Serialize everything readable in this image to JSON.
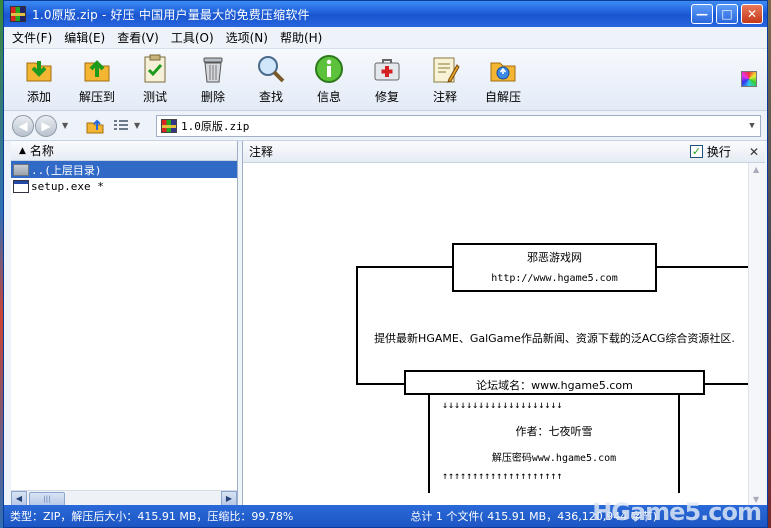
{
  "window": {
    "title": "1.0原版.zip - 好压 中国用户量最大的免费压缩软件",
    "buttons": {
      "minimize": "—",
      "maximize": "□",
      "close": "✕"
    }
  },
  "menu": [
    "文件(F)",
    "编辑(E)",
    "查看(V)",
    "工具(O)",
    "选项(N)",
    "帮助(H)"
  ],
  "toolbar": [
    {
      "label": "添加",
      "icon": "add-icon"
    },
    {
      "label": "解压到",
      "icon": "extract-icon"
    },
    {
      "label": "测试",
      "icon": "test-icon"
    },
    {
      "label": "删除",
      "icon": "delete-icon"
    },
    {
      "label": "查找",
      "icon": "search-icon"
    },
    {
      "label": "信息",
      "icon": "info-icon"
    },
    {
      "label": "修复",
      "icon": "repair-icon"
    },
    {
      "label": "注释",
      "icon": "comment-icon"
    },
    {
      "label": "自解压",
      "icon": "sfx-icon"
    }
  ],
  "address": {
    "path": "1.0原版.zip"
  },
  "file_list": {
    "column": "名称",
    "rows": [
      {
        "name": "..(上层目录)",
        "type": "folder",
        "selected": true
      },
      {
        "name": "setup.exe *",
        "type": "exe",
        "selected": false
      }
    ]
  },
  "comment_pane": {
    "title": "注释",
    "wrap_label": "换行",
    "wrap_checked": true,
    "art": {
      "site_name": "邪恶游戏网",
      "site_url": "http://www.hgame5.com",
      "description": "提供最新HGAME、GalGame作品新闻、资源下载的泛ACG综合资源社区.",
      "forum": "论坛域名：www.hgame5.com",
      "down_arrows": "↓↓↓↓↓↓↓↓↓↓↓↓↓↓↓↓↓↓↓↓",
      "author": "作者：七夜听雪",
      "password": "解压密码www.hgame5.com",
      "up_arrows": "↑↑↑↑↑↑↑↑↑↑↑↑↑↑↑↑↑↑↑↑"
    }
  },
  "status": {
    "left": "类型：ZIP，解压后大小：415.91 MB，压缩比：99.78%",
    "right": "总计 1 个文件( 415.91 MB，436,120,944 字节)"
  },
  "watermark": "HGame5.com"
}
